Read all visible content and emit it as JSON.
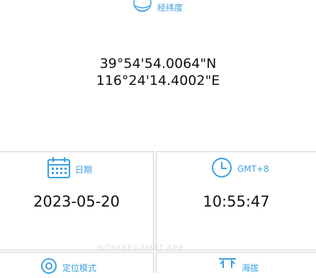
{
  "top": {
    "label": "经纬度",
    "icon": "globe-icon",
    "latitude": "39°54'54.0064\"N",
    "longitude": "116°24'14.4002\"E"
  },
  "date": {
    "label": "日期",
    "value": "2023-05-20",
    "icon": "calendar-icon"
  },
  "time": {
    "label": "GMT+8",
    "value": "10:55:47",
    "icon": "clock-icon"
  },
  "mode": {
    "label": "定位模式",
    "icon": "location-target-icon"
  },
  "altitude": {
    "label": "海拔",
    "icon": "altitude-icon"
  },
  "watermark": "NOFAKEGAMET.APP",
  "colors": {
    "accent": "#3aa0e0",
    "border": "#cfcfcf"
  }
}
